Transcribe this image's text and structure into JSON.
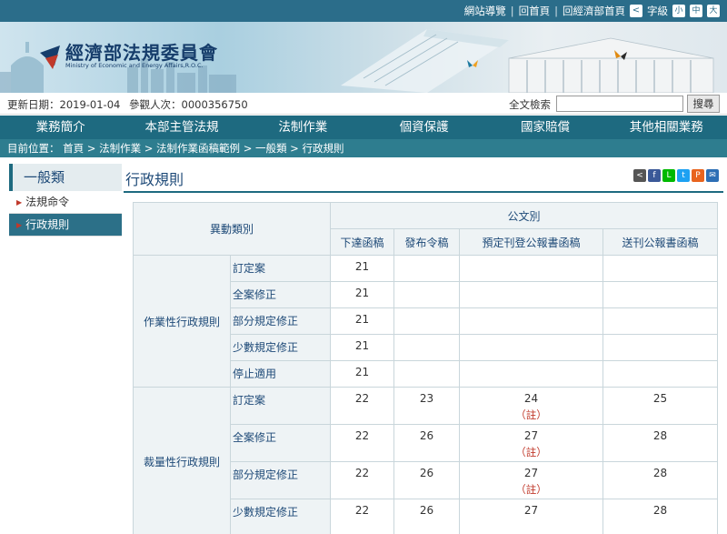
{
  "topbar": {
    "sitemap": "網站導覽",
    "home": "回首頁",
    "moea_home": "回經濟部首頁",
    "font_label": "字級",
    "font_small": "小",
    "font_medium": "中",
    "font_large": "大"
  },
  "banner": {
    "title": "經濟部法規委員會",
    "subtitle": "Ministry of Economic and Energy Affairs,R.O.C."
  },
  "info": {
    "update_date": "更新日期：2019-01-04",
    "visitor_count": "參觀人次：0000356750",
    "search_label": "全文檢索",
    "search_value": "",
    "search_button": "搜尋"
  },
  "nav": {
    "items": [
      "業務簡介",
      "本部主管法規",
      "法制作業",
      "個資保護",
      "國家賠償",
      "其他相關業務"
    ]
  },
  "breadcrumb": {
    "text": "目前位置： 首頁 > 法制作業 > 法制作業函稿範例 > 一般類 > 行政規則"
  },
  "sidebar": {
    "title": "一般類",
    "items": [
      "法規命令",
      "行政規則"
    ]
  },
  "content": {
    "title": "行政規則"
  },
  "table": {
    "head_change_type": "異動類別",
    "head_doc_type": "公文別",
    "columns": [
      "下達函稿",
      "發布令稿",
      "預定刊登公報書函稿",
      "送刊公報書函稿"
    ],
    "note": "（註）",
    "groups": [
      {
        "name": "作業性行政規則",
        "rows": [
          {
            "label": "訂定案",
            "values": [
              "21",
              "",
              "",
              ""
            ]
          },
          {
            "label": "全案修正",
            "values": [
              "21",
              "",
              "",
              ""
            ]
          },
          {
            "label": "部分規定修正",
            "values": [
              "21",
              "",
              "",
              ""
            ]
          },
          {
            "label": "少數規定修正",
            "values": [
              "21",
              "",
              "",
              ""
            ]
          },
          {
            "label": "停止適用",
            "values": [
              "21",
              "",
              "",
              ""
            ]
          }
        ]
      },
      {
        "name": "裁量性行政規則",
        "rows": [
          {
            "label": "訂定案",
            "values": [
              "22",
              "23",
              "24",
              "25"
            ]
          },
          {
            "label": "全案修正",
            "values": [
              "22",
              "26",
              "27",
              "28"
            ]
          },
          {
            "label": "部分規定修正",
            "values": [
              "22",
              "26",
              "27",
              "28"
            ]
          },
          {
            "label": "少數規定修正",
            "values": [
              "22",
              "26",
              "27",
              "28"
            ]
          }
        ]
      }
    ]
  }
}
